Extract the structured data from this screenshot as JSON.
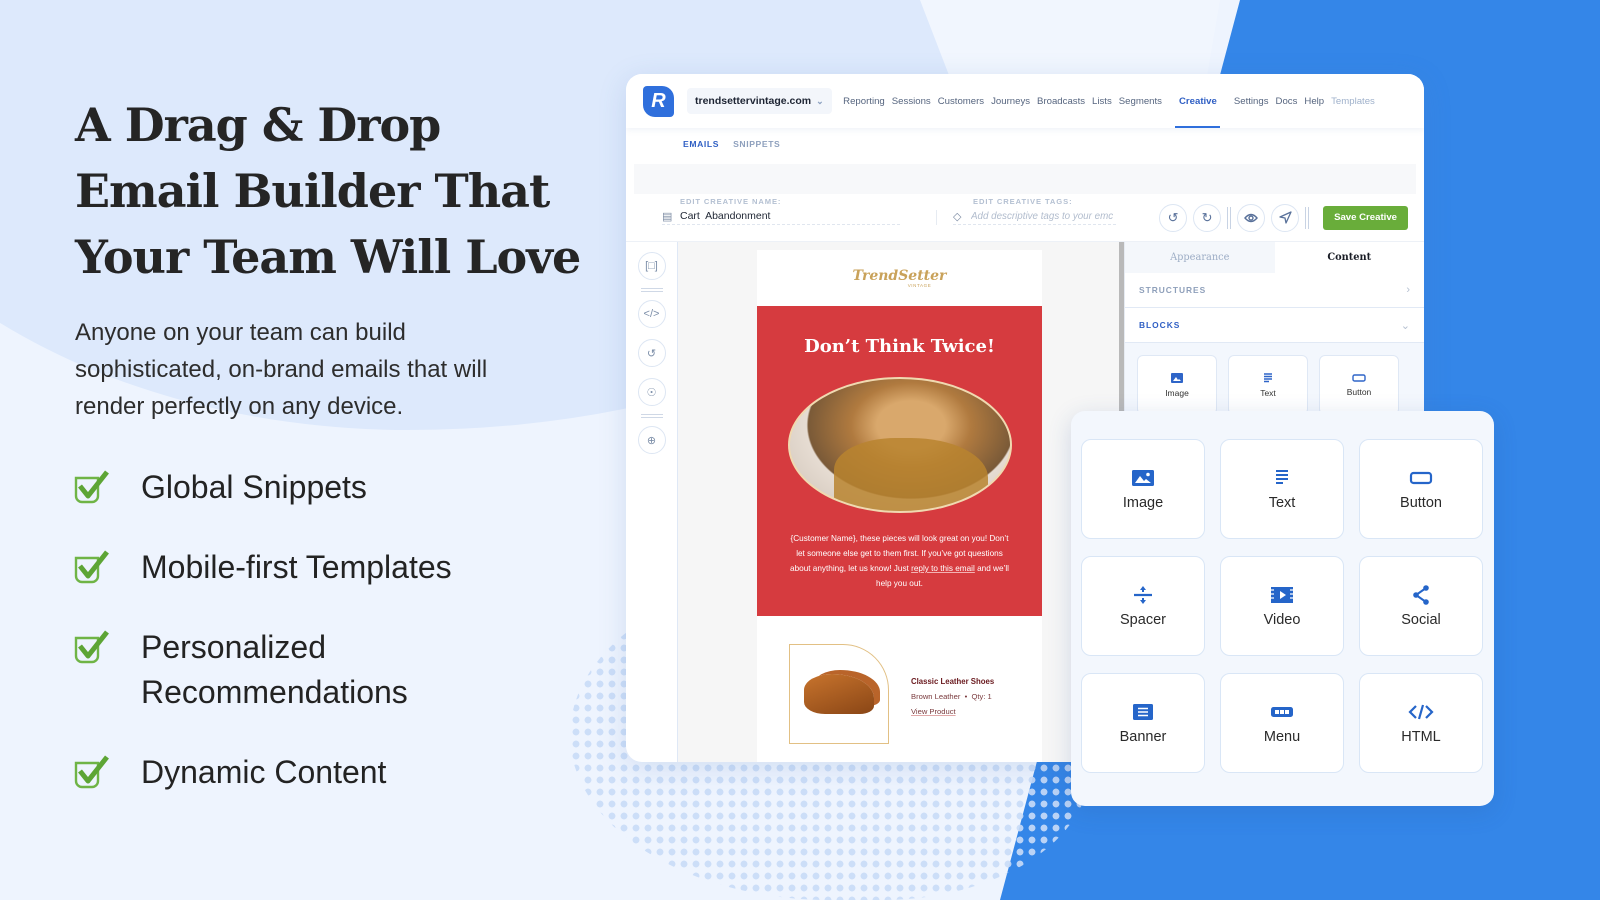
{
  "hero": {
    "headline_lines": [
      "A Drag & Drop",
      "Email Builder That",
      "Your Team Will Love"
    ],
    "subtext": "Anyone on your team can build sophisticated, on-brand emails that will render perfectly on any device."
  },
  "features": [
    {
      "label": "Global Snippets",
      "icon": "checkbox-checked-icon"
    },
    {
      "label": "Mobile-first Templates",
      "icon": "checkbox-checked-icon"
    },
    {
      "label": "Personalized Recommendations",
      "icon": "checkbox-checked-icon"
    },
    {
      "label": "Dynamic Content",
      "icon": "checkbox-checked-icon"
    }
  ],
  "app": {
    "logo_letter": "R",
    "domain": "trendsettervintage.com",
    "nav": [
      "Reporting",
      "Sessions",
      "Customers",
      "Journeys",
      "Broadcasts",
      "Lists",
      "Segments",
      "Creative",
      "Settings",
      "Docs",
      "Help",
      "Templates"
    ],
    "active_nav": "Creative",
    "subtabs": [
      "EMAILS",
      "SNIPPETS"
    ],
    "active_subtab": "EMAILS",
    "name_field": {
      "label": "EDIT CREATIVE NAME:",
      "value": "Cart  Abandonment"
    },
    "tags_field": {
      "label": "EDIT CREATIVE TAGS:",
      "placeholder": "Add descriptive tags to your emc"
    },
    "toolbar_icons": [
      "undo-icon",
      "redo-icon",
      "preview-eye-icon",
      "send-test-icon"
    ],
    "save_label": "Save Creative",
    "rail_icons": [
      "frame-icon",
      "code-icon",
      "history-icon",
      "dynamic-icon",
      "add-snippet-icon"
    ],
    "colors": {
      "accent": "#2f6fdc",
      "save": "#69ad3a",
      "email_red": "#d63b3f",
      "brand_gold": "#c9a25a"
    }
  },
  "email": {
    "brand": "TrendSetter",
    "brand_sub": "VINTAGE",
    "headline": "Don’t Think Twice!",
    "body_pre": "{Customer Name}, these pieces will look great on you! Don’t let someone else get to them first. If you’ve got questions about anything, let us know! Just ",
    "body_link": "reply to this email",
    "body_post": " and we’ll help you out.",
    "product": {
      "title": "Classic Leather Shoes",
      "variant": "Brown Leather",
      "qty": "Qty: 1",
      "link": "View Product"
    }
  },
  "panel": {
    "tabs": [
      "Appearance",
      "Content"
    ],
    "active_tab": "Content",
    "sections": [
      "STRUCTURES",
      "BLOCKS"
    ],
    "mini_blocks": [
      "Image",
      "Text",
      "Button"
    ]
  },
  "blocks": [
    {
      "label": "Image",
      "icon": "image-icon"
    },
    {
      "label": "Text",
      "icon": "text-icon"
    },
    {
      "label": "Button",
      "icon": "button-icon"
    },
    {
      "label": "Spacer",
      "icon": "spacer-icon"
    },
    {
      "label": "Video",
      "icon": "video-icon"
    },
    {
      "label": "Social",
      "icon": "share-icon"
    },
    {
      "label": "Banner",
      "icon": "banner-icon"
    },
    {
      "label": "Menu",
      "icon": "menu-icon"
    },
    {
      "label": "HTML",
      "icon": "html-code-icon"
    }
  ]
}
